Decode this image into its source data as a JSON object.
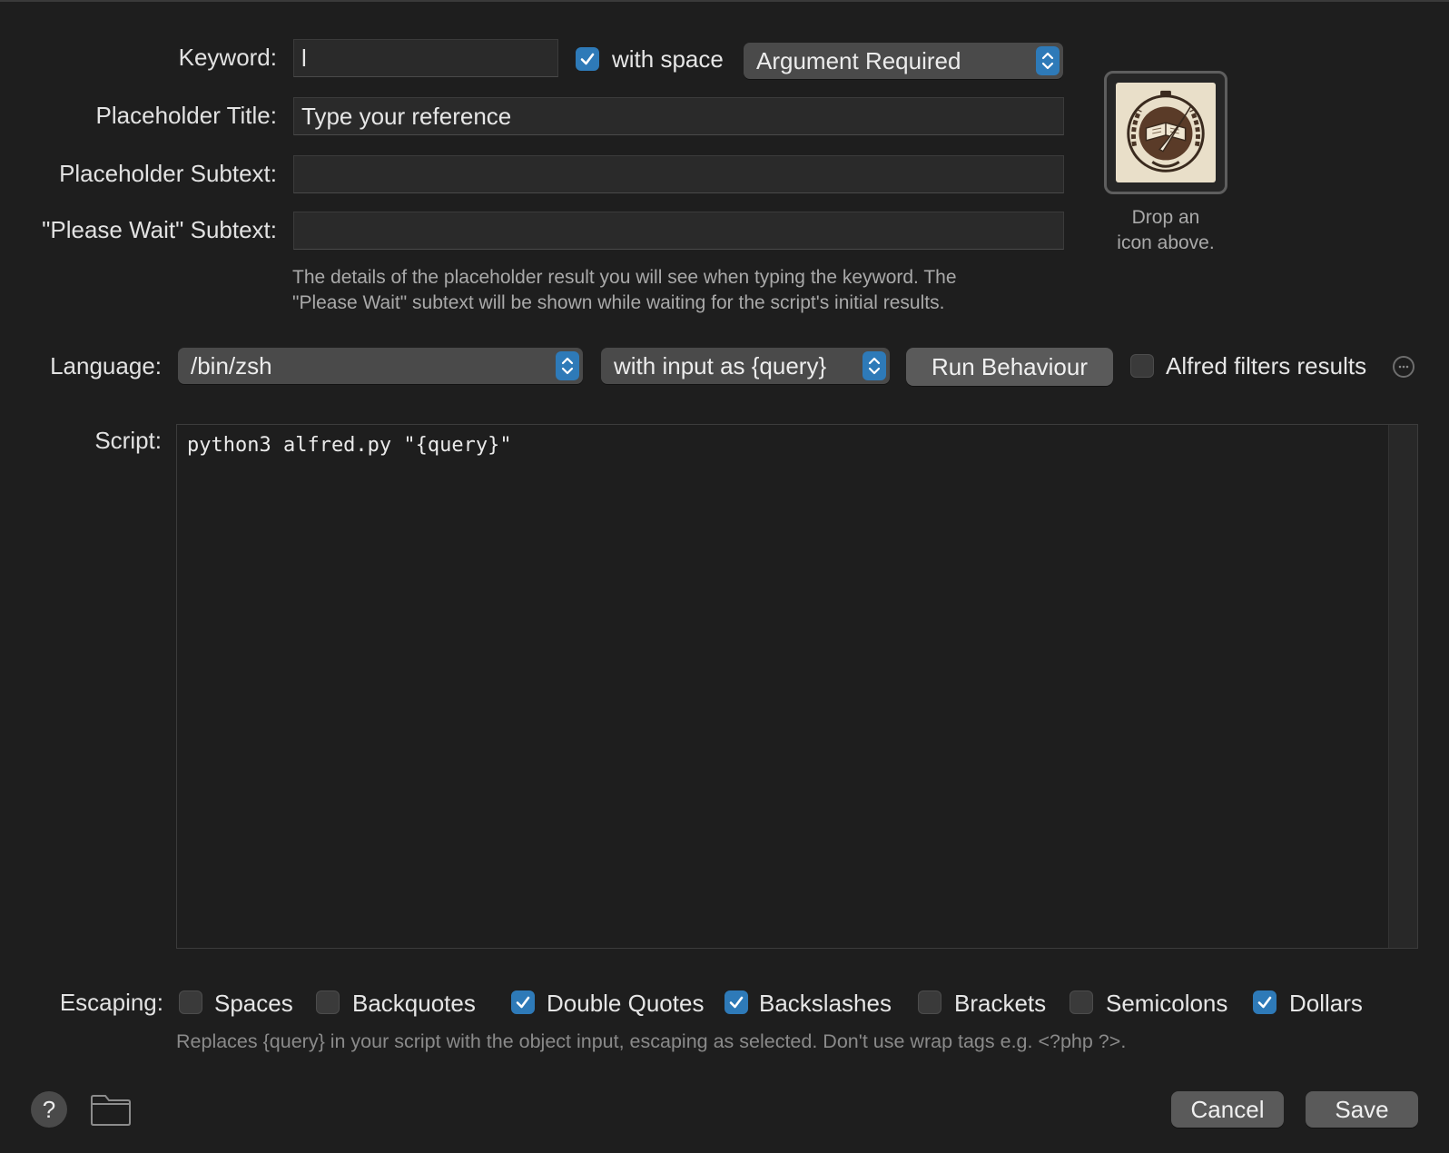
{
  "keyword": {
    "label": "Keyword:",
    "value": "l",
    "with_space_label": "with space",
    "with_space_checked": true,
    "argument_mode": "Argument Required"
  },
  "placeholder_title": {
    "label": "Placeholder Title:",
    "value": "Type your reference"
  },
  "placeholder_subtext": {
    "label": "Placeholder Subtext:",
    "value": ""
  },
  "please_wait_subtext": {
    "label": "\"Please Wait\" Subtext:",
    "value": ""
  },
  "placeholder_hint_line1": "The details of the placeholder result you will see when typing the keyword. The",
  "placeholder_hint_line2": "\"Please Wait\" subtext will be shown while waiting for the script's initial results.",
  "icon_well": {
    "hint_line1": "Drop an",
    "hint_line2": "icon above."
  },
  "language": {
    "label": "Language:",
    "value": "/bin/zsh",
    "input_mode": "with input as {query}",
    "run_behaviour_label": "Run Behaviour",
    "alfred_filters_label": "Alfred filters results",
    "alfred_filters_checked": false
  },
  "script": {
    "label": "Script:",
    "content": "python3 alfred.py \"{query}\""
  },
  "escaping": {
    "label": "Escaping:",
    "options": [
      {
        "label": "Spaces",
        "checked": false
      },
      {
        "label": "Backquotes",
        "checked": false
      },
      {
        "label": "Double Quotes",
        "checked": true
      },
      {
        "label": "Backslashes",
        "checked": true
      },
      {
        "label": "Brackets",
        "checked": false
      },
      {
        "label": "Semicolons",
        "checked": false
      },
      {
        "label": "Dollars",
        "checked": true
      }
    ],
    "hint": "Replaces {query} in your script with the object input, escaping as selected. Don't use wrap tags e.g. <?php ?>."
  },
  "footer": {
    "help_label": "?",
    "cancel_label": "Cancel",
    "save_label": "Save"
  },
  "colors": {
    "accent": "#2e7ab8",
    "background": "#1e1e1e"
  }
}
